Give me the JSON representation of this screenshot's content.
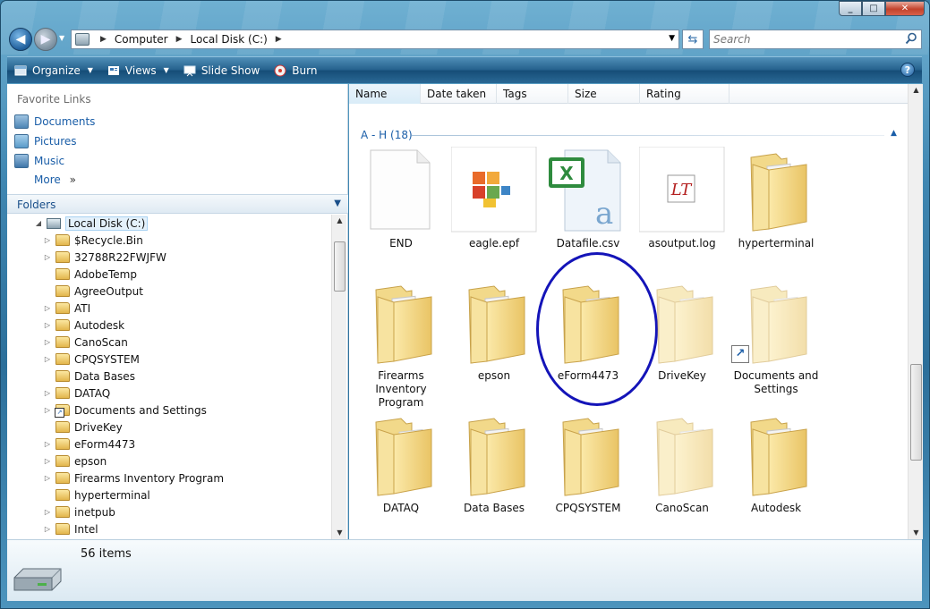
{
  "window": {
    "caption_buttons": [
      "minimize",
      "maximize",
      "close"
    ]
  },
  "address": {
    "crumbs": [
      "Computer",
      "Local Disk (C:)"
    ]
  },
  "search": {
    "placeholder": "Search"
  },
  "toolbar": {
    "organize": "Organize",
    "views": "Views",
    "slideshow": "Slide Show",
    "burn": "Burn",
    "help": "?"
  },
  "favorites": {
    "title": "Favorite Links",
    "items": [
      "Documents",
      "Pictures",
      "Music"
    ],
    "more": "More"
  },
  "folders": {
    "title": "Folders",
    "tree": [
      {
        "label": "Local Disk (C:)",
        "expanded": true,
        "selected": true
      },
      {
        "label": "$Recycle.Bin",
        "expandable": true
      },
      {
        "label": "32788R22FWJFW",
        "expandable": true
      },
      {
        "label": "AdobeTemp",
        "expandable": false
      },
      {
        "label": "AgreeOutput",
        "expandable": false
      },
      {
        "label": "ATI",
        "expandable": true
      },
      {
        "label": "Autodesk",
        "expandable": true
      },
      {
        "label": "CanoScan",
        "expandable": true
      },
      {
        "label": "CPQSYSTEM",
        "expandable": true
      },
      {
        "label": "Data Bases",
        "expandable": false
      },
      {
        "label": "DATAQ",
        "expandable": true
      },
      {
        "label": "Documents and Settings",
        "expandable": true,
        "shortcut": true
      },
      {
        "label": "DriveKey",
        "expandable": false
      },
      {
        "label": "eForm4473",
        "expandable": true
      },
      {
        "label": "epson",
        "expandable": true
      },
      {
        "label": "Firearms Inventory Program",
        "expandable": true
      },
      {
        "label": "hyperterminal",
        "expandable": false
      },
      {
        "label": "inetpub",
        "expandable": true
      },
      {
        "label": "Intel",
        "expandable": true
      }
    ]
  },
  "columns": [
    "Name",
    "Date taken",
    "Tags",
    "Size",
    "Rating"
  ],
  "group": {
    "title": "A - H (18)"
  },
  "items": [
    {
      "label": "END",
      "kind": "blank-file"
    },
    {
      "label": "eagle.epf",
      "kind": "office-file"
    },
    {
      "label": "Datafile.csv",
      "kind": "excel-file"
    },
    {
      "label": "asoutput.log",
      "kind": "log-file"
    },
    {
      "label": "hyperterminal",
      "kind": "folder"
    },
    {
      "label": "Firearms Inventory Program",
      "kind": "folder"
    },
    {
      "label": "epson",
      "kind": "folder"
    },
    {
      "label": "eForm4473",
      "kind": "folder"
    },
    {
      "label": "DriveKey",
      "kind": "folder"
    },
    {
      "label": "Documents and Settings",
      "kind": "folder-shortcut"
    },
    {
      "label": "DATAQ",
      "kind": "folder"
    },
    {
      "label": "Data Bases",
      "kind": "folder"
    },
    {
      "label": "CPQSYSTEM",
      "kind": "folder"
    },
    {
      "label": "CanoScan",
      "kind": "folder"
    },
    {
      "label": "Autodesk",
      "kind": "folder"
    }
  ],
  "details": {
    "count": "56 items"
  }
}
